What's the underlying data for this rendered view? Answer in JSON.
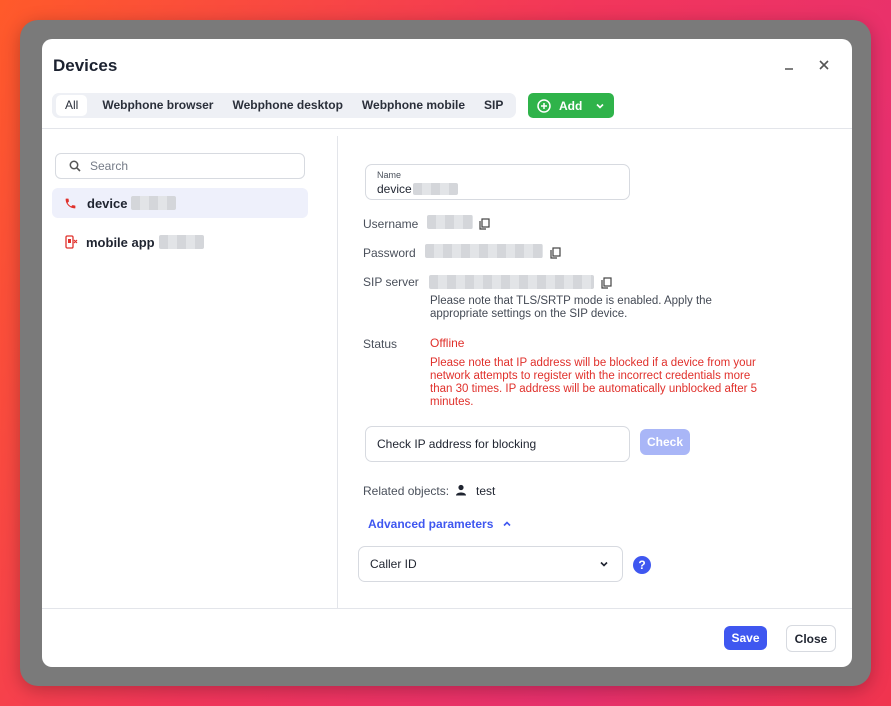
{
  "dialog": {
    "title": "Devices",
    "minimize_icon": "minimize-icon",
    "close_icon": "close-icon"
  },
  "tabs": [
    {
      "label": "All",
      "active": true
    },
    {
      "label": "Webphone browser"
    },
    {
      "label": "Webphone desktop"
    },
    {
      "label": "Webphone mobile"
    },
    {
      "label": "SIP"
    }
  ],
  "add_button": {
    "label": "Add",
    "color": "#2fb34a"
  },
  "search": {
    "placeholder": "Search"
  },
  "devices": [
    {
      "label": "device",
      "icon": "phone-icon",
      "selected": true
    },
    {
      "label": "mobile app",
      "icon": "mobile-phone-icon"
    }
  ],
  "details": {
    "name_label": "Name",
    "name_value": "device",
    "username_label": "Username",
    "password_label": "Password",
    "sip_server_label": "SIP server",
    "sip_note": "Please note that TLS/SRTP mode is enabled. Apply the appropriate settings on the SIP device.",
    "status_label": "Status",
    "status_value": "Offline",
    "status_note": "Please note that IP address will be blocked if a device from your network attempts to register with the incorrect credentials more than 30 times. IP address will be automatically unblocked after 5 minutes.",
    "check_ip_placeholder": "Check IP address for blocking",
    "check_button": "Check",
    "related_label": "Related objects:",
    "related_value": "test",
    "advanced_label": "Advanced parameters",
    "caller_id_label": "Caller ID",
    "help_icon": "?"
  },
  "footer": {
    "save": "Save",
    "close": "Close"
  },
  "colors": {
    "accent": "#3f57f0",
    "danger": "#e0302b",
    "success": "#2fb34a"
  }
}
